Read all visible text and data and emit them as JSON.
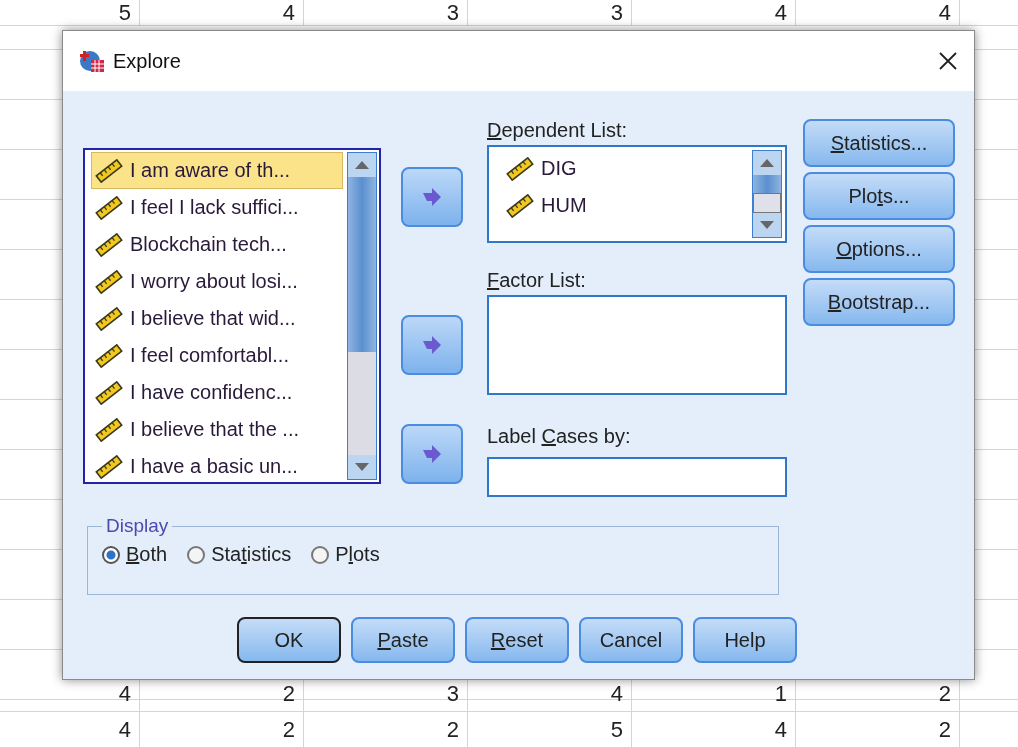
{
  "sheet": {
    "top_row": [
      "5",
      "4",
      "3",
      "3",
      "4",
      "4"
    ],
    "bottom_rows": [
      [
        "4",
        "2",
        "3",
        "4",
        "1",
        "2"
      ],
      [
        "4",
        "2",
        "2",
        "5",
        "4",
        "2"
      ]
    ]
  },
  "window": {
    "title": "Explore"
  },
  "variables": [
    {
      "label": "I am aware of th...",
      "selected": true
    },
    {
      "label": "I feel I lack suffici...",
      "selected": false
    },
    {
      "label": "Blockchain tech...",
      "selected": false
    },
    {
      "label": "I worry about losi...",
      "selected": false
    },
    {
      "label": "I believe that wid...",
      "selected": false
    },
    {
      "label": "I feel comfortabl...",
      "selected": false
    },
    {
      "label": "I have confidenc...",
      "selected": false
    },
    {
      "label": "I believe that the ...",
      "selected": false
    },
    {
      "label": "I have a basic un...",
      "selected": false
    }
  ],
  "dependent_list": {
    "label": {
      "key": "D",
      "post": "ependent List:"
    },
    "items": [
      "DIG",
      "HUM"
    ]
  },
  "factor_list": {
    "label": {
      "key": "F",
      "post": "actor List:"
    }
  },
  "label_cases": {
    "label": {
      "pre": "Label ",
      "key": "C",
      "post": "ases by:"
    }
  },
  "side_buttons": [
    {
      "key": "S",
      "post": "tatistics..."
    },
    {
      "pre": "Plo",
      "key": "t",
      "post": "s..."
    },
    {
      "key": "O",
      "post": "ptions..."
    },
    {
      "key": "B",
      "post": "ootstrap..."
    }
  ],
  "display": {
    "title": "Display",
    "options": [
      {
        "key": "B",
        "post": "oth",
        "selected": true
      },
      {
        "pre": "Sta",
        "key": "t",
        "post": "istics",
        "selected": false
      },
      {
        "pre": "P",
        "key": "l",
        "post": "ots",
        "selected": false
      }
    ]
  },
  "buttons": [
    {
      "pre": "OK",
      "default": true
    },
    {
      "key": "P",
      "post": "aste",
      "default": false
    },
    {
      "key": "R",
      "post": "eset",
      "default": false
    },
    {
      "pre": "Cancel",
      "default": false
    },
    {
      "pre": "Help",
      "default": false
    }
  ]
}
